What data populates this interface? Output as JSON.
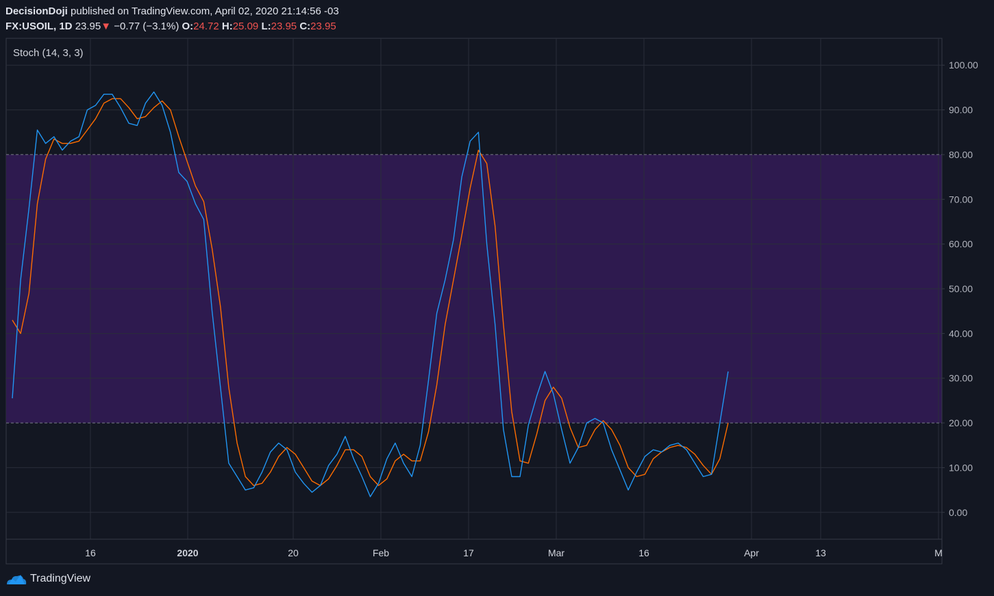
{
  "header": {
    "author": "DecisionDoji",
    "published_text": "published on TradingView.com, April 02, 2020 21:14:56 -03",
    "symbol": "FX:USOIL, 1D",
    "last_price": "23.95",
    "change_arrow": "▼",
    "change": "−0.77 (−3.1%)",
    "open_label": "O:",
    "open_value": "24.72",
    "high_label": "H:",
    "high_value": "25.09",
    "low_label": "L:",
    "low_value": "23.95",
    "close_label": "C:",
    "close_value": "23.95"
  },
  "indicator_label": "Stoch (14, 3, 3)",
  "footer": {
    "brand": "TradingView"
  },
  "colors": {
    "background": "#131722",
    "band_fill": "#2e1a4f",
    "k_line": "#2196f3",
    "d_line": "#ff6d00",
    "grid": "#2a2e39",
    "negative": "#ef5350"
  },
  "chart_data": {
    "type": "line",
    "title": "Stoch (14, 3, 3)",
    "y_ticks": [
      "100.00",
      "90.00",
      "80.00",
      "70.00",
      "60.00",
      "50.00",
      "40.00",
      "30.00",
      "20.00",
      "10.00",
      "0.00"
    ],
    "y_range": [
      -6,
      106
    ],
    "x_tick_labels": [
      "16",
      "2020",
      "20",
      "Feb",
      "17",
      "Mar",
      "16",
      "Apr",
      "13",
      "M"
    ],
    "bands": {
      "upper": 80,
      "lower": 20
    },
    "grid": true,
    "series": [
      {
        "key": "k",
        "color": "#2196f3",
        "values": [
          25.5,
          52,
          68,
          85.5,
          82.5,
          84,
          81,
          83,
          84,
          90,
          91,
          93.5,
          93.5,
          90.5,
          87,
          86.5,
          91.5,
          94,
          91,
          85,
          76,
          74,
          69,
          65.5,
          45,
          28,
          11,
          8,
          5,
          5.5,
          9,
          13.5,
          15.5,
          14,
          9,
          6.5,
          4.5,
          6,
          10.5,
          13,
          17,
          12,
          8,
          3.5,
          6.5,
          12,
          15.5,
          11,
          8,
          15,
          29.5,
          44.5,
          52,
          61,
          75,
          83,
          85,
          60,
          42,
          18.5,
          8,
          8,
          19.5,
          26,
          31.5,
          26.5,
          18.5,
          11,
          14.5,
          20,
          21,
          20,
          14,
          9.5,
          5,
          9,
          12.5,
          14,
          13.5,
          15,
          15.5,
          14,
          11,
          8,
          8.5,
          20,
          31.5
        ]
      },
      {
        "key": "d",
        "color": "#ff6d00",
        "values": [
          43,
          40,
          49,
          69,
          79,
          83.5,
          82.5,
          82.5,
          83,
          85.5,
          88,
          91.5,
          92.5,
          92.5,
          90.5,
          88,
          88.5,
          90.5,
          92,
          90,
          84,
          78.5,
          73,
          69.5,
          59,
          46,
          28,
          15.5,
          8,
          6,
          6.5,
          9,
          12.5,
          14.5,
          13,
          10,
          7,
          6,
          7.5,
          10.5,
          14,
          14,
          12.5,
          8,
          6,
          7.5,
          11.5,
          13,
          11.5,
          11.5,
          18,
          28.5,
          42,
          52,
          62,
          72.5,
          81,
          78,
          64,
          42,
          22.5,
          11.5,
          11,
          17.5,
          25,
          28,
          25.5,
          19,
          14.5,
          15,
          18.5,
          20.5,
          18.5,
          15,
          10,
          8,
          8.5,
          12,
          13.5,
          14.5,
          15,
          14.5,
          13,
          10.5,
          8.5,
          12,
          20
        ]
      }
    ]
  }
}
